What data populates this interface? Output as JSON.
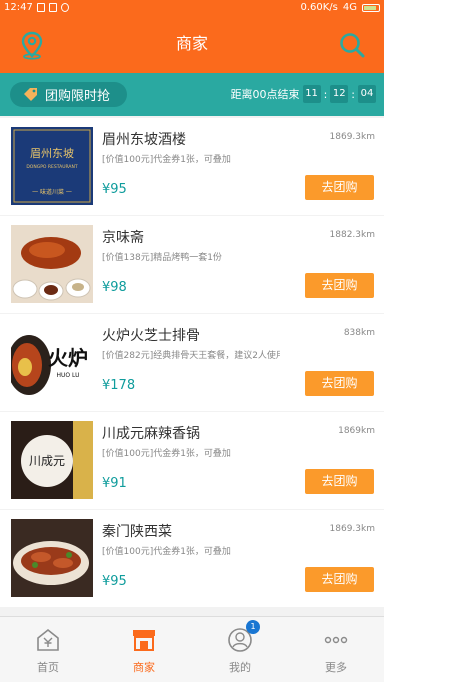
{
  "status_bar": {
    "time": "12:47",
    "network": "0.60K/s",
    "signal": "4G"
  },
  "header": {
    "title": "商家"
  },
  "promo": {
    "label": "团购限时抢",
    "countdown_label": "距离00点结束",
    "hours": "11",
    "minutes": "12",
    "seconds": "04"
  },
  "items": [
    {
      "name": "眉州东坡酒楼",
      "distance": "1869.3km",
      "desc": "[价值100元]代金券1张，可叠加",
      "price": "¥95",
      "button": "去团购",
      "thumb_text": "眉州东坡",
      "thumb_sub": "DONGPO RESTAURANT",
      "thumb_bottom": "一 味道川菜 一"
    },
    {
      "name": "京味斋",
      "distance": "1882.3km",
      "desc": "[价值138元]精品烤鸭一套1份",
      "price": "¥98",
      "button": "去团购"
    },
    {
      "name": "火炉火芝士排骨",
      "distance": "838km",
      "desc": "[价值282元]经典排骨天王套餐，建议2人使用",
      "price": "¥178",
      "button": "去团购",
      "thumb_text": "火炉",
      "thumb_sub": "HUO LU"
    },
    {
      "name": "川成元麻辣香锅",
      "distance": "1869km",
      "desc": "[价值100元]代金券1张，可叠加",
      "price": "¥91",
      "button": "去团购",
      "thumb_text": "川成元"
    },
    {
      "name": "秦门陕西菜",
      "distance": "1869.3km",
      "desc": "[价值100元]代金券1张，可叠加",
      "price": "¥95",
      "button": "去团购"
    }
  ],
  "tabs": [
    {
      "label": "首页",
      "icon": "home-yen-icon"
    },
    {
      "label": "商家",
      "icon": "shop-icon"
    },
    {
      "label": "我的",
      "icon": "user-icon",
      "badge": "1"
    },
    {
      "label": "更多",
      "icon": "more-icon"
    }
  ],
  "colors": {
    "brand": "#fb6a1c",
    "teal": "#2aa9a1",
    "button": "#fb9a2b",
    "price": "#0f9c9c"
  }
}
